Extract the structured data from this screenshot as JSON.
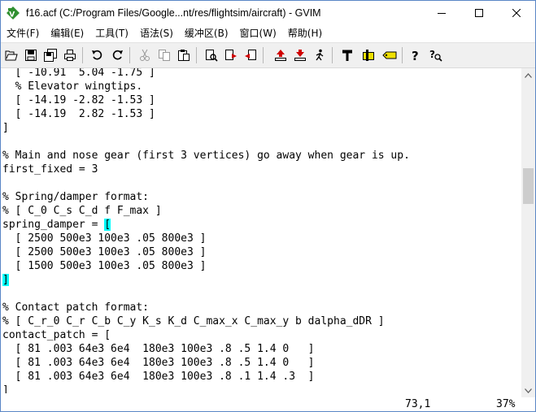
{
  "window": {
    "title": "f16.acf (C:/Program Files/Google...nt/res/flightsim/aircraft) - GVIM",
    "controls": {
      "minimize": "minimize",
      "maximize": "maximize",
      "close": "close"
    }
  },
  "menu": {
    "items": [
      "文件(F)",
      "编辑(E)",
      "工具(T)",
      "语法(S)",
      "缓冲区(B)",
      "窗口(W)",
      "帮助(H)"
    ]
  },
  "toolbar": {
    "buttons": [
      "open-icon",
      "save-icon",
      "save-all-icon",
      "print-icon",
      "undo-icon",
      "redo-icon",
      "cut-icon",
      "copy-icon",
      "paste-icon",
      "find-replace-icon",
      "find-next-icon",
      "find-prev-icon",
      "load-session-icon",
      "save-session-icon",
      "run-script-icon",
      "make-icon",
      "run-shell-icon",
      "ctags-icon",
      "help-icon",
      "find-help-icon"
    ]
  },
  "editor": {
    "lines": [
      "  [ -10.91  5.04 -1.75 ]",
      "  % Elevator wingtips.",
      "  [ -14.19 -2.82 -1.53 ]",
      "  [ -14.19  2.82 -1.53 ]",
      "]",
      "",
      "% Main and nose gear (first 3 vertices) go away when gear is up.",
      "first_fixed = 3",
      "",
      "% Spring/damper format:",
      "% [ C_0 C_s C_d f F_max ]",
      "spring_damper = [",
      "  [ 2500 500e3 100e3 .05 800e3 ]",
      "  [ 2500 500e3 100e3 .05 800e3 ]",
      "  [ 1500 500e3 100e3 .05 800e3 ]",
      "]",
      "",
      "",
      "% Contact patch format:",
      "% [ C_r_0 C_r C_b C_y K_s K_d C_max_x C_max_y b dalpha_dDR ]",
      "contact_patch = [",
      "  [ 81 .003 64e3 6e4  180e3 100e3 .8 .5 1.4 0   ]",
      "  [ 81 .003 64e3 6e4  180e3 100e3 .8 .5 1.4 0   ]",
      "  [ 81 .003 64e3 6e4  180e3 100e3 .8 .1 1.4 .3  ]",
      "]"
    ],
    "highlight_color": "#00ffff"
  },
  "status": {
    "position": "73,1",
    "percent": "37%"
  },
  "colors": {
    "border": "#5a86c6",
    "toolbar_bg": "#f0f0f0",
    "match_paren": "#00ffff"
  }
}
